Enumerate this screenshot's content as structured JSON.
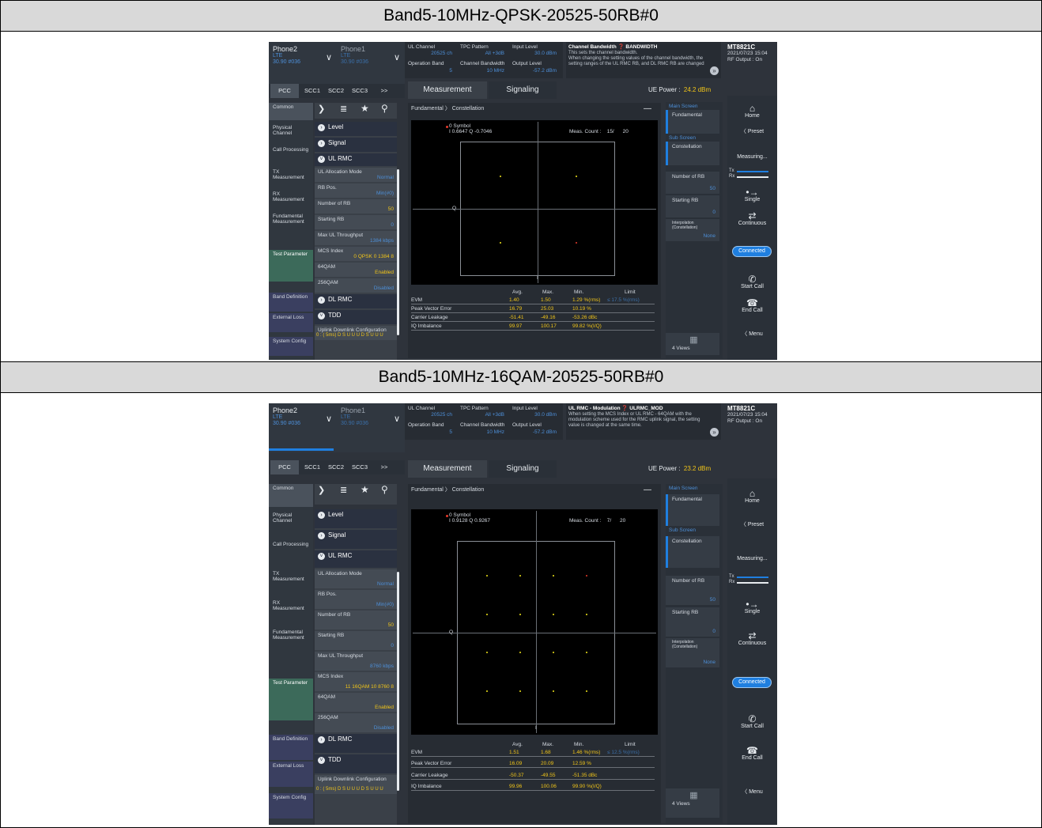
{
  "headers": [
    "Band5-10MHz-QPSK-20525-50RB#0",
    "Band5-10MHz-16QAM-20525-50RB#0"
  ],
  "screens": [
    {
      "phone2": {
        "name": "Phone2",
        "tech": "LTE",
        "sub": "30.90 #036"
      },
      "phone1": {
        "name": "Phone1",
        "tech": "LTE",
        "sub": "30.90 #036"
      },
      "top": {
        "ul_channel_label": "UL Channel",
        "ul_channel_value": "20525 ch",
        "tpc_label": "TPC Pattern",
        "tpc_value": "All +3dB",
        "input_level_label": "Input Level",
        "input_level_value": "30.0 dBm",
        "op_band_label": "Operation Band",
        "op_band_value": "5",
        "chbw_label": "Channel Bandwidth",
        "chbw_value": "10 MHz",
        "output_level_label": "Output Level",
        "output_level_value": "-57.2 dBm"
      },
      "info": {
        "title": "Channel Bandwidth ❓ BANDWIDTH",
        "line1": "This sets the channel bandwidth.",
        "line2": "When changing the setting values of the channel bandwidth, the",
        "line3": "setting ranges of the UL RMC RB, and DL RMC RB are changed"
      },
      "brand": {
        "name": "MT8821C",
        "date": "2021/07/23 15:04",
        "rf": "RF Output : On"
      },
      "scc_tabs": [
        "PCC",
        "SCC1",
        "SCC2",
        "SCC3",
        ">>"
      ],
      "main_tabs": [
        "Measurement",
        "Signaling"
      ],
      "ue_power_label": "UE Power :",
      "ue_power_value": "24.2 dBm",
      "nav": [
        "Common",
        "Physical Channel",
        "Call Processing",
        "TX Measurement",
        "RX Measurement",
        "Fundamental Measurement",
        "Test Parameter",
        "Band Definition",
        "External Loss",
        "System Config"
      ],
      "params": {
        "level": "Level",
        "signal": "Signal",
        "ulrmc": "UL RMC",
        "alloc_label": "UL Allocation Mode",
        "alloc_value": "Normal",
        "rbpos_label": "RB Pos.",
        "rbpos_value": "Min(#0)",
        "nrb_label": "Number of RB",
        "nrb_value": "50",
        "srb_label": "Starting RB",
        "srb_value": "0",
        "thr_label": "Max UL Throughput",
        "thr_value": "1384 kbps",
        "mcs_label": "MCS Index",
        "mcs_value": "0  QPSK  0  1384  8",
        "q64_label": "64QAM",
        "q64_value": "Enabled",
        "q256_label": "256QAM",
        "q256_value": "Disabled",
        "dlrmc": "DL RMC",
        "tdd": "TDD",
        "uldl_label": "Uplink Downlink Configuration",
        "uldl_value": "0 : ( 5ms) D S U U U D S U U U"
      },
      "panel": {
        "breadcrumb": "Fundamental 〉 Constellation",
        "symbol": "0 Symbol",
        "iq": "I 0.6647 Q -0.7046",
        "meas_count_label": "Meas. Count :",
        "meas_count_value": "15/",
        "meas_count_total": "20",
        "q_label": "Q",
        "i_label": "I"
      },
      "table": {
        "headers": [
          "Avg.",
          "Max.",
          "Min.",
          "Limit"
        ],
        "rows": [
          {
            "name": "EVM",
            "avg": "1.40",
            "max": "1.50",
            "min": "1.29 %(rms)",
            "limit": "≤ 17.5 %(rms)"
          },
          {
            "name": "Peak Vector Error",
            "avg": "16.79",
            "max": "25.03",
            "min": "10.19 %",
            "limit": ""
          },
          {
            "name": "Carrier Leakage",
            "avg": "-51.41",
            "max": "-49.16",
            "min": "-53.26 dBc",
            "limit": ""
          },
          {
            "name": "IQ Imbalance",
            "avg": "99.97",
            "max": "100.17",
            "min": "99.82 %(I/Q)",
            "limit": ""
          }
        ]
      },
      "right": {
        "main_screen": "Main Screen",
        "fundamental": "Fundamental",
        "sub_screen": "Sub Screen",
        "constellation": "Constellation",
        "nrb_label": "Number of RB",
        "nrb_value": "50",
        "srb_label": "Starting RB",
        "srb_value": "0",
        "interp_label": "Interpolation (Constellation)",
        "interp_value": "None",
        "views": "4 Views"
      },
      "far": {
        "home": "Home",
        "preset": "Preset",
        "measuring": "Measuring...",
        "tx": "Tx",
        "rx": "Rx",
        "single": "Single",
        "continuous": "Continuous",
        "connected": "Connected",
        "start_call": "Start Call",
        "end_call": "End Call",
        "menu": "Menu"
      },
      "constellation": {
        "points": [
          [
            -0.7,
            0.7
          ],
          [
            0.7,
            0.7
          ],
          [
            -0.7,
            -0.7
          ],
          [
            0.7,
            -0.7
          ]
        ],
        "colors": [
          "#f0e419",
          "#f0e419",
          "#f0e419",
          "#e83a2a"
        ]
      }
    },
    {
      "phone2": {
        "name": "Phone2",
        "tech": "LTE",
        "sub": "30.90 #036"
      },
      "phone1": {
        "name": "Phone1",
        "tech": "LTE",
        "sub": "30.90 #036"
      },
      "top": {
        "ul_channel_label": "UL Channel",
        "ul_channel_value": "20525 ch",
        "tpc_label": "TPC Pattern",
        "tpc_value": "All +3dB",
        "input_level_label": "Input Level",
        "input_level_value": "30.0 dBm",
        "op_band_label": "Operation Band",
        "op_band_value": "5",
        "chbw_label": "Channel Bandwidth",
        "chbw_value": "10 MHz",
        "output_level_label": "Output Level",
        "output_level_value": "-57.2 dBm"
      },
      "info": {
        "title": "UL RMC - Modulation ❓ ULRMC_MOD",
        "line1": "When setting the MCS Index or UL RMC - 64QAM with the",
        "line2": "modulation scheme used for the RMC uplink signal, the setting",
        "line3": "value is changed at the same time."
      },
      "brand": {
        "name": "MT8821C",
        "date": "2021/07/23 15:04",
        "rf": "RF Output : On"
      },
      "scc_tabs": [
        "PCC",
        "SCC1",
        "SCC2",
        "SCC3",
        ">>"
      ],
      "main_tabs": [
        "Measurement",
        "Signaling"
      ],
      "ue_power_label": "UE Power :",
      "ue_power_value": "23.2 dBm",
      "nav": [
        "Common",
        "Physical Channel",
        "Call Processing",
        "TX Measurement",
        "RX Measurement",
        "Fundamental Measurement",
        "Test Parameter",
        "Band Definition",
        "External Loss",
        "System Config"
      ],
      "params": {
        "level": "Level",
        "signal": "Signal",
        "ulrmc": "UL RMC",
        "alloc_label": "UL Allocation Mode",
        "alloc_value": "Normal",
        "rbpos_label": "RB Pos.",
        "rbpos_value": "Min(#0)",
        "nrb_label": "Number of RB",
        "nrb_value": "50",
        "srb_label": "Starting RB",
        "srb_value": "0",
        "thr_label": "Max UL Throughput",
        "thr_value": "8760 kbps",
        "mcs_label": "MCS Index",
        "mcs_value": "11  16QAM  10  8760  8",
        "q64_label": "64QAM",
        "q64_value": "Enabled",
        "q256_label": "256QAM",
        "q256_value": "Disabled",
        "dlrmc": "DL RMC",
        "tdd": "TDD",
        "uldl_label": "Uplink Downlink Configuration",
        "uldl_value": "0 : ( 5ms) D S U U U D S U U U"
      },
      "panel": {
        "breadcrumb": "Fundamental 〉 Constellation",
        "symbol": "0 Symbol",
        "iq": "I 0.9128 Q 0.9267",
        "meas_count_label": "Meas. Count :",
        "meas_count_value": "7/",
        "meas_count_total": "20",
        "q_label": "Q",
        "i_label": "I"
      },
      "table": {
        "headers": [
          "Avg.",
          "Max.",
          "Min.",
          "Limit"
        ],
        "rows": [
          {
            "name": "EVM",
            "avg": "1.51",
            "max": "1.68",
            "min": "1.46 %(rms)",
            "limit": "≤ 12.5 %(rms)"
          },
          {
            "name": "Peak Vector Error",
            "avg": "16.09",
            "max": "20.09",
            "min": "12.59 %",
            "limit": ""
          },
          {
            "name": "Carrier Leakage",
            "avg": "-50.37",
            "max": "-49.55",
            "min": "-51.35 dBc",
            "limit": ""
          },
          {
            "name": "IQ Imbalance",
            "avg": "99.96",
            "max": "100.06",
            "min": "99.90 %(I/Q)",
            "limit": ""
          }
        ]
      },
      "right": {
        "main_screen": "Main Screen",
        "fundamental": "Fundamental",
        "sub_screen": "Sub Screen",
        "constellation": "Constellation",
        "nrb_label": "Number of RB",
        "nrb_value": "50",
        "srb_label": "Starting RB",
        "srb_value": "0",
        "interp_label": "Interpolation (Constellation)",
        "interp_value": "None",
        "views": "4 Views"
      },
      "far": {
        "home": "Home",
        "preset": "Preset",
        "measuring": "Measuring...",
        "tx": "Tx",
        "rx": "Rx",
        "single": "Single",
        "continuous": "Continuous",
        "connected": "Connected",
        "start_call": "Start Call",
        "end_call": "End Call",
        "menu": "Menu"
      },
      "constellation": {
        "points": [
          [
            -0.9,
            0.9
          ],
          [
            -0.3,
            0.9
          ],
          [
            0.3,
            0.9
          ],
          [
            0.9,
            0.9
          ],
          [
            -0.9,
            0.3
          ],
          [
            -0.3,
            0.3
          ],
          [
            0.3,
            0.3
          ],
          [
            0.9,
            0.3
          ],
          [
            -0.9,
            -0.3
          ],
          [
            -0.3,
            -0.3
          ],
          [
            0.3,
            -0.3
          ],
          [
            0.9,
            -0.3
          ],
          [
            -0.9,
            -0.9
          ],
          [
            -0.3,
            -0.9
          ],
          [
            0.3,
            -0.9
          ],
          [
            0.9,
            -0.9
          ]
        ],
        "colors": [
          "#f0e419",
          "#f0e419",
          "#f0e419",
          "#e83a2a",
          "#f0e419",
          "#f0e419",
          "#f0e419",
          "#f0e419",
          "#f0e419",
          "#f0e419",
          "#f0e419",
          "#f0e419",
          "#f0e419",
          "#f0e419",
          "#f0e419",
          "#f0e419"
        ]
      }
    }
  ]
}
